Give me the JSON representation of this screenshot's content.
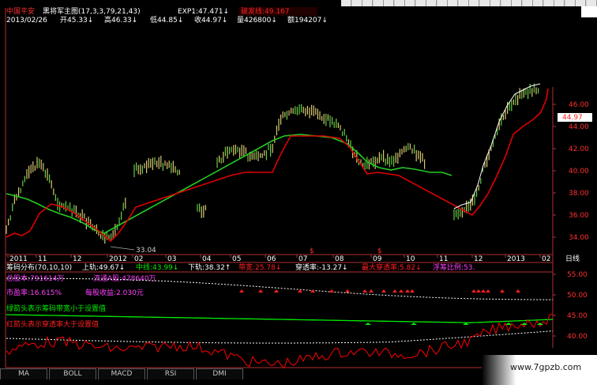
{
  "header": {
    "stock_name": "中国平安",
    "indicator": "黑将军主图(17,3,3,79,21,43)",
    "exp": "EXP1:47.471↓",
    "indicator2": "破发线:49.167",
    "date": "2013/02/26",
    "open": "开45.33↓",
    "high": "高46.33↓",
    "low": "低44.85↓",
    "close": "收44.97↓",
    "volume": "量426800↓",
    "amount": "额194207↓"
  },
  "main_chart": {
    "price_ticks": [
      "46.00",
      "44.00",
      "42.00",
      "40.00",
      "38.00",
      "36.00",
      "34.00"
    ],
    "current_price": "44.97",
    "low_marker": "33.04",
    "time_axis": [
      "2011",
      "11",
      "12",
      "2012",
      "02",
      "03",
      "04",
      "05",
      "06",
      "07",
      "08",
      "09",
      "10",
      "11",
      "12",
      "2013",
      "02"
    ],
    "time_label": "日线",
    "colors": {
      "candle": "#d8c870",
      "green_line": "#22cc22",
      "red_line": "#e00000",
      "white_line": "#ffffff"
    }
  },
  "sub_chart": {
    "title": "筹码分布(70,10,10)",
    "upper": "上轨:49.67↓",
    "middle": "中线:43.99↓",
    "lower": "下轨:38.32↑",
    "bandwidth": "带宽:25.78↓",
    "penetration": "穿透率:-13.27↓",
    "max_penetration": "最大穿透率:5.82↓",
    "float_ratio": "浮筹比例:53.",
    "total_shares": "总股本:791614万",
    "float_shares": "流通A股:478640万",
    "pe": "市盈率:16.615%",
    "eps": "每股收益:2.030元",
    "note_green": "绿箭头表示筹码带宽小于设置值",
    "note_red": "红箭头表示穿透率大于设置值",
    "ticks": [
      "55.00",
      "50.00",
      "45.00",
      "40.00"
    ],
    "colors": {
      "red": "#ff0000",
      "green": "#00ee00",
      "magenta": "#ff40ff",
      "blue": "#5070ff"
    }
  },
  "tabs": [
    "MA",
    "BOLL",
    "MACD",
    "RSI",
    "DMI"
  ],
  "watermark": "www.7gpzb.com"
}
